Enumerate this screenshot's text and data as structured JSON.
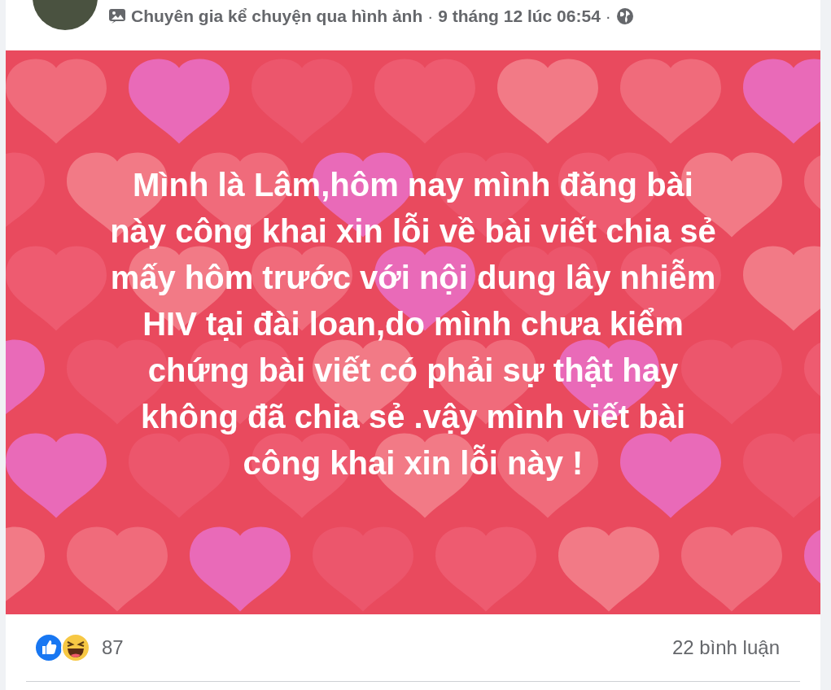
{
  "post": {
    "header": {
      "author_status": "Chuyên gia kể chuyện qua hình ảnh",
      "separator_1": "·",
      "time": "9 tháng 12 lúc 06:54",
      "separator_2": "·"
    },
    "text_lines": [
      "Mình là Lâm,hôm nay mình đăng bài",
      "này công khai xin lỗi về bài viết chia sẻ",
      "mấy hôm trước với nội dung lây nhiễm",
      "HIV tại đài loan,do mình chưa kiểm",
      "chứng bài viết có phải sự thật hay",
      "không đã chia sẻ .vậy mình viết bài",
      "công khai xin lỗi này !"
    ],
    "reaction_count": "87",
    "comments": "22 bình luận"
  }
}
